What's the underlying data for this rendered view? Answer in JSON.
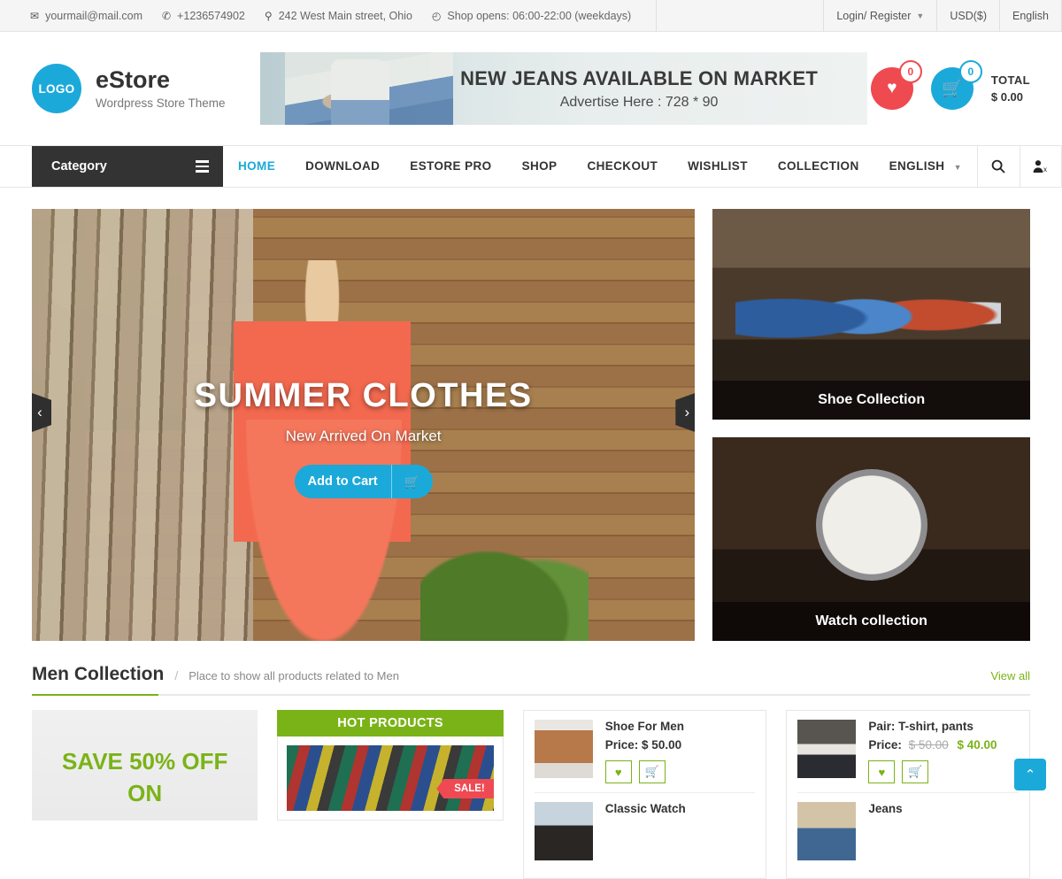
{
  "topbar": {
    "email": "yourmail@mail.com",
    "phone": "+1236574902",
    "address": "242 West Main street, Ohio",
    "hours": "Shop opens: 06:00-22:00 (weekdays)",
    "login": "Login/ Register",
    "currency": "USD($)",
    "language": "English"
  },
  "header": {
    "logo_text": "LOGO",
    "brand_name": "eStore",
    "brand_tagline": "Wordpress Store Theme",
    "ad_title": "NEW JEANS AVAILABLE ON MARKET",
    "ad_subtitle": "Advertise Here : 728 * 90",
    "wishlist_count": "0",
    "cart_count": "0",
    "total_label": "TOTAL",
    "total_amount": "$ 0.00"
  },
  "nav": {
    "category_label": "Category",
    "links": [
      {
        "label": "HOME",
        "active": true
      },
      {
        "label": "DOWNLOAD",
        "active": false
      },
      {
        "label": "ESTORE PRO",
        "active": false
      },
      {
        "label": "SHOP",
        "active": false
      },
      {
        "label": "CHECKOUT",
        "active": false
      },
      {
        "label": "WISHLIST",
        "active": false
      },
      {
        "label": "COLLECTION",
        "active": false
      },
      {
        "label": "ENGLISH",
        "active": false
      }
    ]
  },
  "slider": {
    "title": "SUMMER CLOTHES",
    "subtitle": "New Arrived On Market",
    "button_label": "Add to Cart",
    "prev_label": "‹",
    "next_label": "›"
  },
  "promos": [
    {
      "label": "Shoe Collection"
    },
    {
      "label": "Watch collection"
    }
  ],
  "section": {
    "title": "Men Collection",
    "separator": "/",
    "description": "Place to show all products related to Men",
    "view_all": "View all"
  },
  "save_card": {
    "line1": "SAVE 50% OFF",
    "line2": "ON"
  },
  "hot_products": {
    "heading": "HOT PRODUCTS",
    "badge": "SALE!"
  },
  "products_left": [
    {
      "name": "Shoe For Men",
      "price_label": "Price:",
      "price": "$ 50.00",
      "old_price": "",
      "new_price": ""
    },
    {
      "name": "Classic Watch",
      "price_label": "",
      "price": "",
      "old_price": "",
      "new_price": ""
    }
  ],
  "products_right": [
    {
      "name": "Pair: T-shirt, pants",
      "price_label": "Price:",
      "price": "",
      "old_price": "$ 50.00",
      "new_price": "$ 40.00"
    },
    {
      "name": "Jeans",
      "price_label": "",
      "price": "",
      "old_price": "",
      "new_price": ""
    }
  ],
  "colors": {
    "accent_blue": "#1ba9da",
    "accent_green": "#7ab317",
    "accent_red": "#ee4a50",
    "dark": "#333333"
  }
}
